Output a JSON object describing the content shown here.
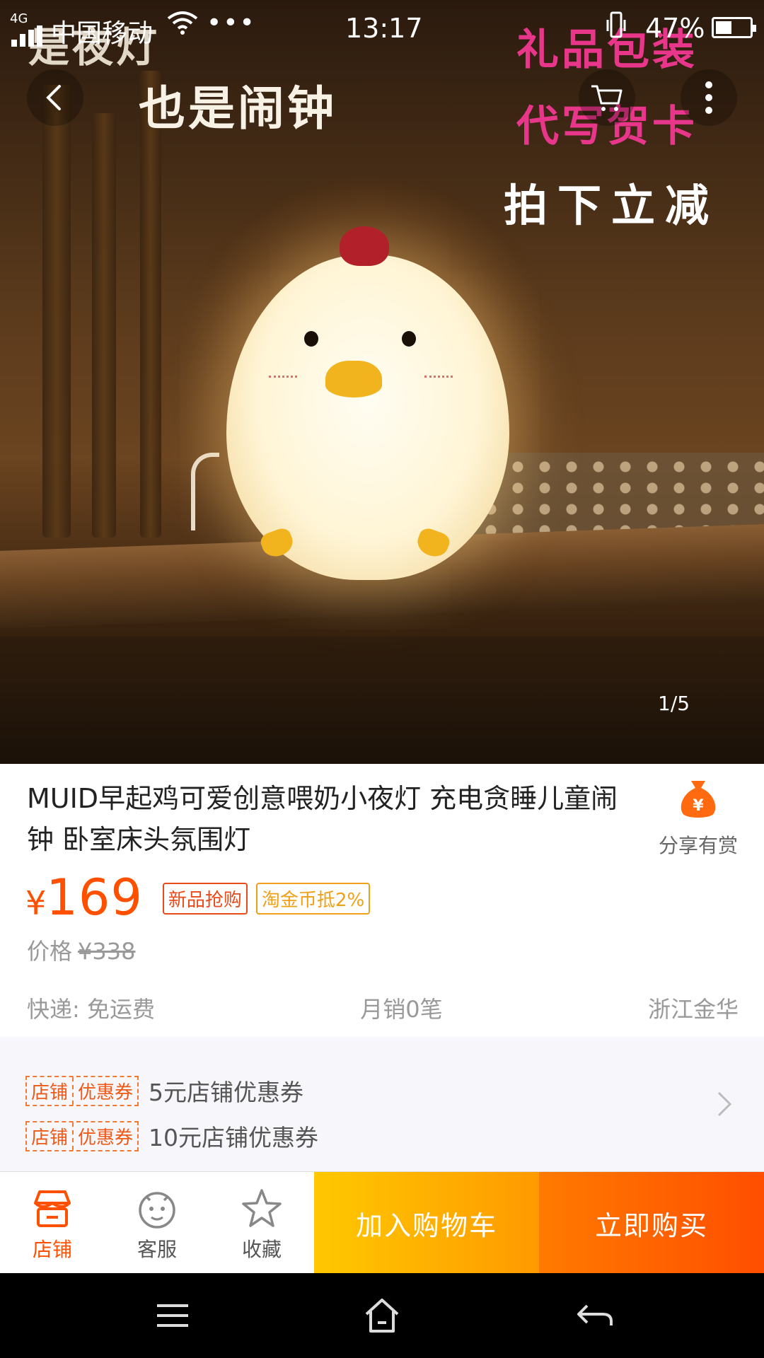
{
  "status_bar": {
    "network": "4G",
    "carrier": "中国移动",
    "more": "•••",
    "time": "13:17",
    "battery_percent": "47%",
    "battery_level": 0.47
  },
  "hero": {
    "overlay_partial": "是夜灯",
    "overlay_clock": "也是闹钟",
    "overlay_gift_line1": "礼品包装",
    "overlay_gift_line2": "代写贺卡",
    "overlay_discount": "拍下立减",
    "image_counter": "1/5"
  },
  "product": {
    "title": "MUID早起鸡可爱创意喂奶小夜灯 充电贪睡儿童闹钟 卧室床头氛围灯",
    "share_label": "分享有赏",
    "currency": "¥",
    "price": "169",
    "tags": [
      "新品抢购",
      "淘金币抵2%"
    ],
    "original_price_label": "价格",
    "original_price": "¥338",
    "shipping": "快递: 免运费",
    "monthly_sales": "月销0笔",
    "location": "浙江金华"
  },
  "coupons": [
    {
      "badge_left": "店铺",
      "badge_right": "优惠券",
      "text": "5元店铺优惠券"
    },
    {
      "badge_left": "店铺",
      "badge_right": "优惠券",
      "text": "10元店铺优惠券"
    }
  ],
  "action_bar": {
    "store_label": "店铺",
    "service_label": "客服",
    "favorite_label": "收藏",
    "add_to_cart": "加入购物车",
    "buy_now": "立即购买"
  },
  "colors": {
    "accent": "#ff5000",
    "cart_gradient_start": "#ffc800",
    "buy_gradient_end": "#ff4e00",
    "overlay_pink": "#e8368a"
  },
  "icons": {
    "back": "back-arrow-icon",
    "cart": "cart-icon",
    "more": "more-vertical-icon",
    "share": "money-bag-icon",
    "store": "store-icon",
    "service": "smiley-face-icon",
    "favorite": "star-icon",
    "chevron": "chevron-right-icon"
  }
}
